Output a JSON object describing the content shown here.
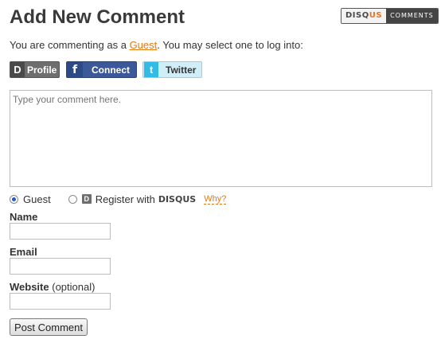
{
  "header": {
    "title": "Add New Comment",
    "badge": {
      "left_prefix": "DISQ",
      "left_suffix": "US",
      "right": "COMMENTS"
    }
  },
  "intro": {
    "before": "You are commenting as a ",
    "guest_link": "Guest",
    "after": ". You may select one to log into:"
  },
  "login": {
    "profile": {
      "icon": "D",
      "label": "Profile"
    },
    "connect": {
      "icon": "f",
      "label": "Connect"
    },
    "twitter": {
      "icon": "t",
      "label": "Twitter"
    }
  },
  "comment": {
    "placeholder": "Type your comment here."
  },
  "identity": {
    "guest_label": "Guest",
    "register_label": "Register with",
    "register_brand": "DISQUS",
    "why_link": "Why?",
    "selected": "Guest"
  },
  "fields": {
    "name_label": "Name",
    "email_label": "Email",
    "website_label": "Website",
    "website_optional": "(optional)",
    "name_value": "",
    "email_value": "",
    "website_value": ""
  },
  "submit": {
    "label": "Post Comment"
  },
  "colors": {
    "accent_link": "#e07a18",
    "facebook_blue": "#3b5998",
    "twitter_light": "#cfeef8"
  }
}
